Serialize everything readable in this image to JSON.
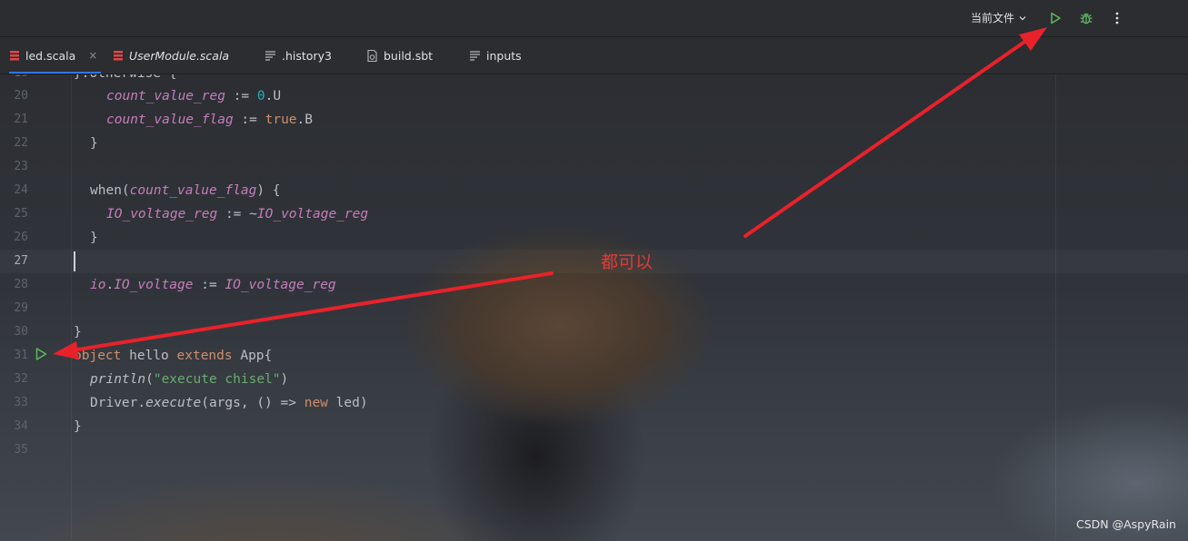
{
  "toolbar": {
    "run_config_label": "当前文件",
    "run_icon": "run-triangle-icon",
    "debug_icon": "bug-icon",
    "more_icon": "vertical-ellipsis-icon"
  },
  "tabs": [
    {
      "label": "led.scala",
      "active": true,
      "icon": "scala-icon",
      "close": "×"
    },
    {
      "label": "UserModule.scala",
      "active": false,
      "icon": "scala-icon"
    },
    {
      "label": ".history3",
      "active": false,
      "icon": "text-file-icon"
    },
    {
      "label": "build.sbt",
      "active": false,
      "icon": "sbt-file-icon"
    },
    {
      "label": "inputs",
      "active": false,
      "icon": "text-file-icon"
    }
  ],
  "editor": {
    "partial_top_line": "}.otherwise {",
    "lines": [
      {
        "n": "20"
      },
      {
        "n": "21"
      },
      {
        "n": "22"
      },
      {
        "n": "23"
      },
      {
        "n": "24"
      },
      {
        "n": "25"
      },
      {
        "n": "26"
      },
      {
        "n": "27"
      },
      {
        "n": "28"
      },
      {
        "n": "29"
      },
      {
        "n": "30"
      },
      {
        "n": "31"
      },
      {
        "n": "32"
      },
      {
        "n": "33"
      },
      {
        "n": "34"
      },
      {
        "n": "35"
      }
    ]
  },
  "annotation": {
    "text": "都可以",
    "color": "#e23a3a"
  },
  "watermark": "CSDN @AspyRain",
  "colors": {
    "background": "#26282c",
    "tab_active_underline": "#3574f0",
    "run_green": "#5fb85f",
    "arrow_red": "#e8222a"
  }
}
